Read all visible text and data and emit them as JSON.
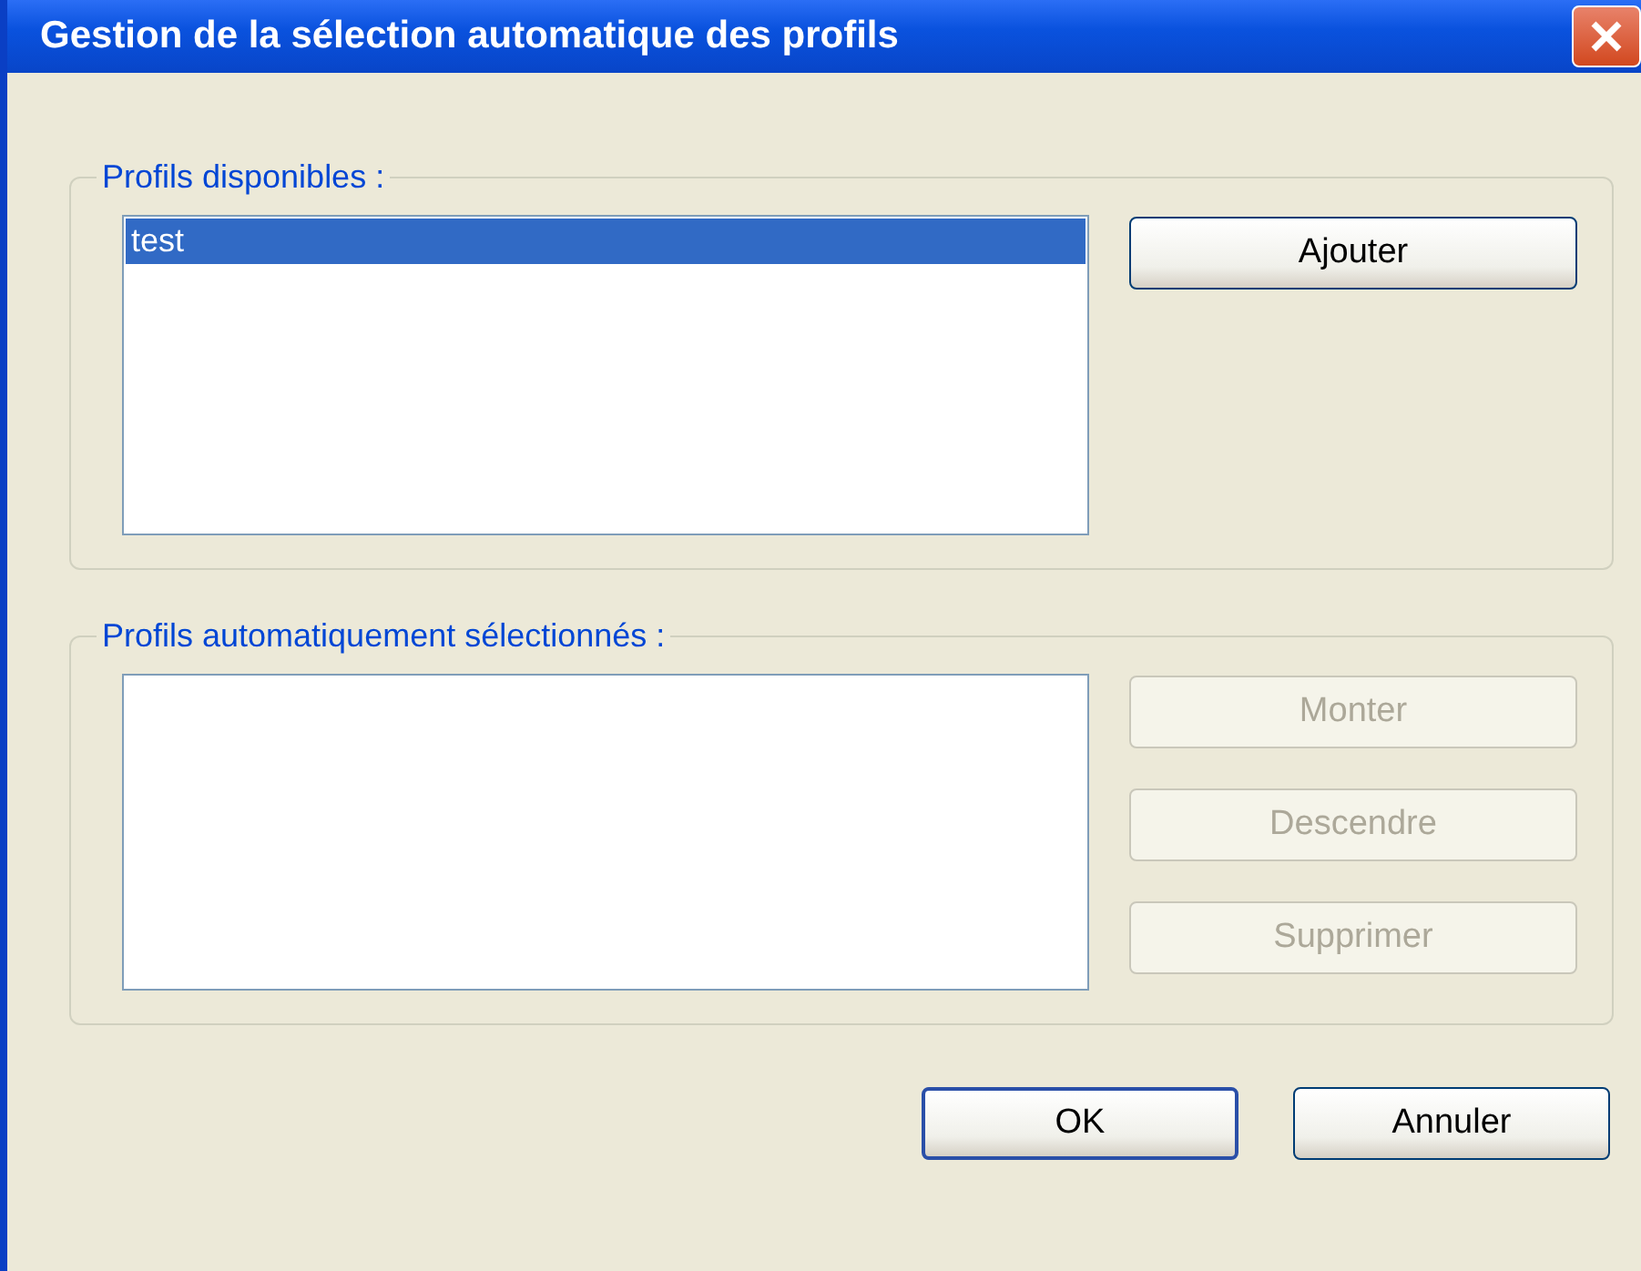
{
  "window": {
    "title": "Gestion de la sélection automatique des profils"
  },
  "groups": [
    {
      "legend": "Profils disponibles :",
      "items": [
        {
          "label": "test",
          "selected": true
        }
      ],
      "buttons": [
        {
          "label": "Ajouter",
          "disabled": false
        }
      ]
    },
    {
      "legend": "Profils automatiquement sélectionnés :",
      "buttons": [
        {
          "label": "Monter",
          "disabled": true
        },
        {
          "label": "Descendre",
          "disabled": true
        },
        {
          "label": "Supprimer",
          "disabled": true
        }
      ]
    }
  ],
  "footer_buttons": [
    {
      "label": "OK",
      "default": true
    },
    {
      "label": "Annuler",
      "default": false
    }
  ]
}
